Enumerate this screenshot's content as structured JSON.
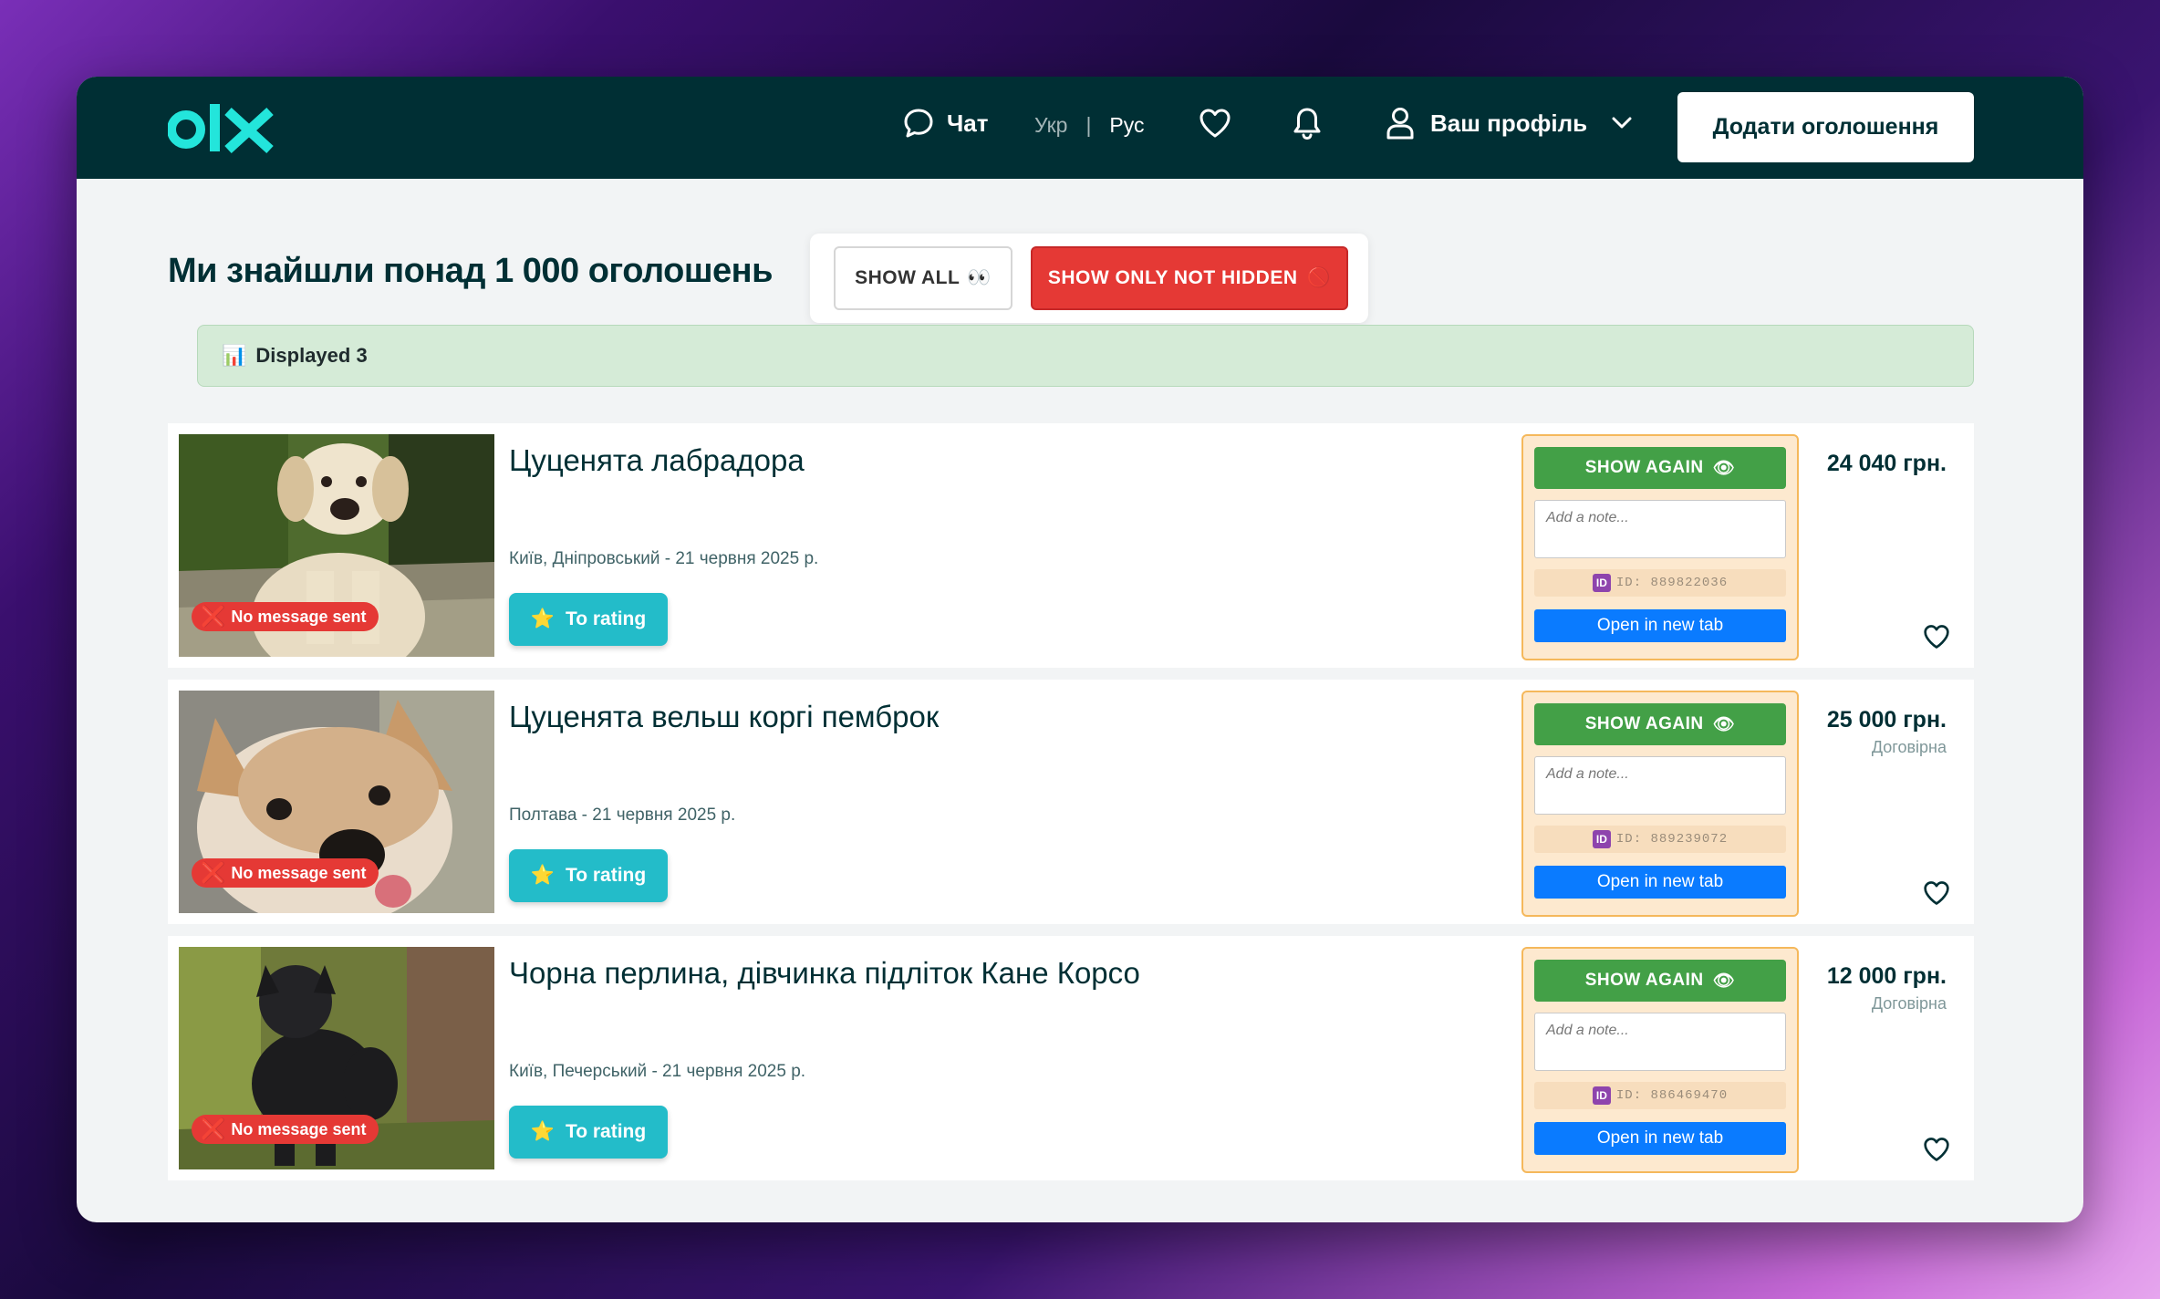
{
  "header": {
    "logo_text": "olx",
    "chat_label": "Чат",
    "lang_ukr": "Укр",
    "lang_sep": "|",
    "lang_rus": "Рус",
    "profile_label": "Ваш профіль",
    "add_button": "Додати оголошення",
    "colors": {
      "bg": "#002f34",
      "logo": "#23e5db"
    }
  },
  "main": {
    "heading": "Ми знайшли понад 1 000 оголошень",
    "filters": {
      "show_all": "SHOW ALL",
      "show_all_icon": "👀",
      "show_not_hidden": "SHOW ONLY NOT HIDDEN",
      "show_not_hidden_icon": "🚫"
    },
    "displayed_icon": "📊",
    "displayed_text": "Displayed 3"
  },
  "listings": [
    {
      "title": "Цуценята лабрадора",
      "location": "Київ, Дніпровський - 21 червня 2025 р.",
      "badge": "No message sent",
      "badge_icon": "❌",
      "rating_label": "To rating",
      "rating_icon": "⭐",
      "show_again": "SHOW AGAIN",
      "show_again_icon": "👁",
      "note_placeholder": "Add a note...",
      "id_text": "ID: 889822036",
      "id_icon": "🆔",
      "open_tab": "Open in new tab",
      "price": "24 040 грн.",
      "negotiable": "",
      "image": "labrador-puppy"
    },
    {
      "title": "Цуценята вельш коргі пемброк",
      "location": "Полтава - 21 червня 2025 р.",
      "badge": "No message sent",
      "badge_icon": "❌",
      "rating_label": "To rating",
      "rating_icon": "⭐",
      "show_again": "SHOW AGAIN",
      "show_again_icon": "👁",
      "note_placeholder": "Add a note...",
      "id_text": "ID: 889239072",
      "id_icon": "🆔",
      "open_tab": "Open in new tab",
      "price": "25 000 грн.",
      "negotiable": "Договірна",
      "image": "corgi-puppy"
    },
    {
      "title": "Чорна перлина, дівчинка підліток Кане Корсо",
      "location": "Київ, Печерський - 21 червня 2025 р.",
      "badge": "No message sent",
      "badge_icon": "❌",
      "rating_label": "To rating",
      "rating_icon": "⭐",
      "show_again": "SHOW AGAIN",
      "show_again_icon": "👁",
      "note_placeholder": "Add a note...",
      "id_text": "ID: 886469470",
      "id_icon": "🆔",
      "open_tab": "Open in new tab",
      "price": "12 000 грн.",
      "negotiable": "Договірна",
      "image": "cane-corso-dog"
    }
  ]
}
